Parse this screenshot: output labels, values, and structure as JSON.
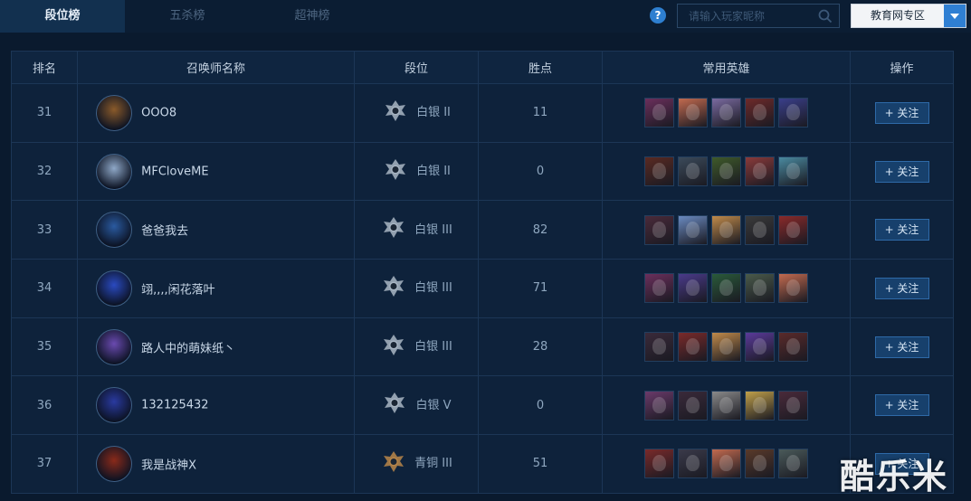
{
  "tabs": [
    {
      "label": "段位榜",
      "active": true
    },
    {
      "label": "五杀榜",
      "active": false
    },
    {
      "label": "超神榜",
      "active": false
    }
  ],
  "help_label": "?",
  "search": {
    "placeholder": "请输入玩家昵称",
    "icon": "search-icon"
  },
  "region_select": {
    "value": "教育网专区"
  },
  "table": {
    "headers": [
      "排名",
      "召唤师名称",
      "段位",
      "胜点",
      "常用英雄",
      "操作"
    ],
    "rows": [
      {
        "rank": "31",
        "name": "OOO8",
        "tier": "白银 II",
        "tier_kind": "silver",
        "points": "11",
        "avatar_color": "#8a5a2a",
        "heroes": [
          "#6b2f5c",
          "#c26a4f",
          "#7a6aa0",
          "#6e2a2a",
          "#3a3f8a"
        ]
      },
      {
        "rank": "32",
        "name": "MFCloveME",
        "tier": "白银 II",
        "tier_kind": "silver",
        "points": "0",
        "avatar_color": "#8fa8c8",
        "heroes": [
          "#5a2a22",
          "#3b4a5a",
          "#3f5a2a",
          "#8a3a3a",
          "#4a8aa0"
        ]
      },
      {
        "rank": "33",
        "name": "爸爸我去",
        "tier": "白银 III",
        "tier_kind": "silver",
        "points": "82",
        "avatar_color": "#2a5aa0",
        "heroes": [
          "#4a2a3a",
          "#6a8ac0",
          "#c08a4a",
          "#3a3a3a",
          "#8a2a2a"
        ]
      },
      {
        "rank": "34",
        "name": "翊,,,,闲花落叶",
        "tier": "白银 III",
        "tier_kind": "silver",
        "points": "71",
        "avatar_color": "#2a4ac0",
        "heroes": [
          "#6b2f5c",
          "#4a3a8a",
          "#2a5a3a",
          "#4a5a4a",
          "#c26a4f"
        ]
      },
      {
        "rank": "35",
        "name": "路人中的萌妹纸丶",
        "tier": "白银 III",
        "tier_kind": "silver",
        "points": "28",
        "avatar_color": "#6a4ab0",
        "heroes": [
          "#3a2a3a",
          "#7a2a2a",
          "#c08a4a",
          "#5a3a9a",
          "#5a2a2a"
        ]
      },
      {
        "rank": "36",
        "name": "132125432",
        "tier": "白银 V",
        "tier_kind": "silver",
        "points": "0",
        "avatar_color": "#2a3aa0",
        "heroes": [
          "#6a3a6a",
          "#3a2a3a",
          "#8a8a8a",
          "#c0a04a",
          "#4a2a3a"
        ]
      },
      {
        "rank": "37",
        "name": "我是战神X",
        "tier": "青铜 III",
        "tier_kind": "bronze",
        "points": "51",
        "avatar_color": "#8a2a1a",
        "heroes": [
          "#7a2a2a",
          "#3a3a4a",
          "#c26a4f",
          "#5a3a2a",
          "#4a5a5a"
        ]
      }
    ],
    "follow_label": "+ 关注"
  },
  "watermark": "酷乐米"
}
